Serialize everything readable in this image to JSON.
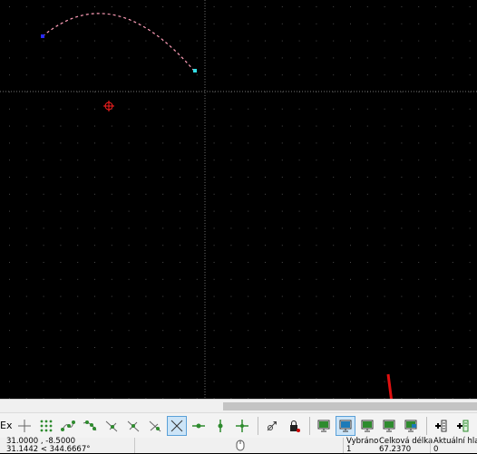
{
  "toolbar": {
    "cut_label": "Ex"
  },
  "status": {
    "coords": "31.0000 , -8.5000",
    "polar": "31.1442 < 344.6667°",
    "selected_label": "Vybráno",
    "selected_value": "1",
    "length_label": "Celková délka",
    "length_value": "67.2370",
    "current_label": "Aktuální hla",
    "current_value": "0"
  },
  "colors": {
    "background": "#000000",
    "grid_dot": "#4a4a4a",
    "arc": "#ff9db8",
    "start_point": "#2a2aff",
    "end_point": "#33dfe6",
    "marker": "#ff2020",
    "arrow": "#e01010"
  }
}
